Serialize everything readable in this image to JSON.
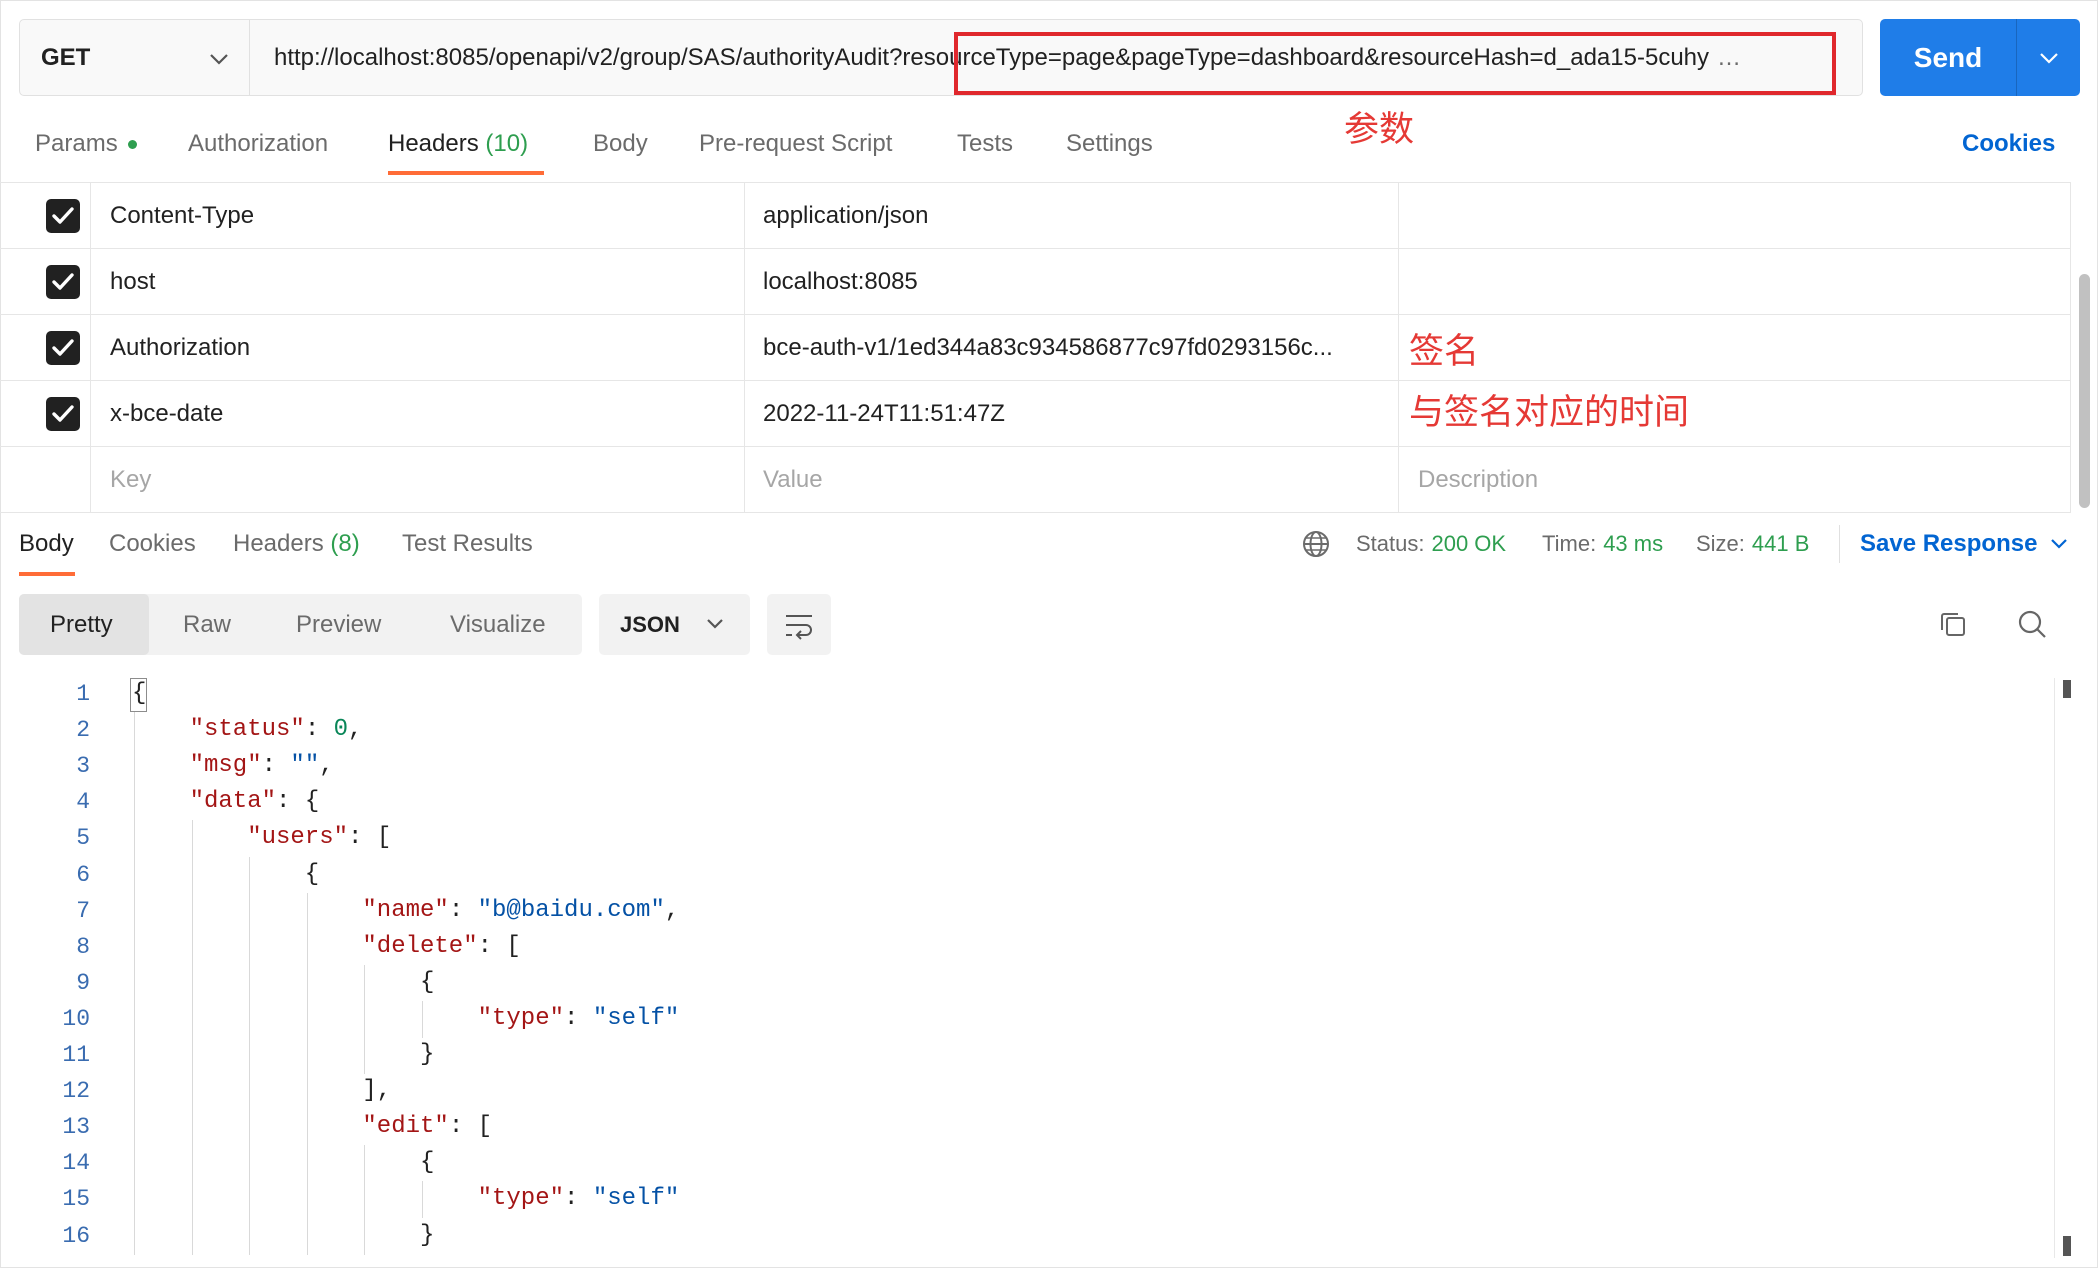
{
  "request": {
    "method": "GET",
    "url": "http://localhost:8085/openapi/v2/group/SAS/authorityAudit?resourceType=page&pageType=dashboard&resourceHash=d_ada15-5cuhy",
    "send_label": "Send"
  },
  "request_tabs": {
    "params": "Params",
    "params_has_values": true,
    "authorization": "Authorization",
    "headers": "Headers",
    "headers_count": "(10)",
    "body": "Body",
    "pre_request_script": "Pre-request Script",
    "tests": "Tests",
    "settings": "Settings",
    "active": "Headers",
    "cookies_link": "Cookies"
  },
  "annotations": {
    "params_note": "参数",
    "signature_note": "签名",
    "signature_time_note": "与签名对应的时间"
  },
  "headers_table": {
    "rows": [
      {
        "checked": true,
        "key": "Content-Type",
        "value": "application/json",
        "description": ""
      },
      {
        "checked": true,
        "key": "host",
        "value": "localhost:8085",
        "description": ""
      },
      {
        "checked": true,
        "key": "Authorization",
        "value": "bce-auth-v1/1ed344a83c934586877c97fd0293156c...",
        "description": ""
      },
      {
        "checked": true,
        "key": "x-bce-date",
        "value": "2022-11-24T11:51:47Z",
        "description": ""
      }
    ],
    "placeholder": {
      "key": "Key",
      "value": "Value",
      "description": "Description"
    }
  },
  "response_tabs": {
    "body": "Body",
    "cookies": "Cookies",
    "headers": "Headers",
    "headers_count": "(8)",
    "test_results": "Test Results",
    "active": "Body"
  },
  "response_status": {
    "status_label": "Status:",
    "status_value": "200 OK",
    "time_label": "Time:",
    "time_value": "43 ms",
    "size_label": "Size:",
    "size_value": "441 B",
    "save_response": "Save Response"
  },
  "response_toolbar": {
    "view_modes": [
      "Pretty",
      "Raw",
      "Preview",
      "Visualize"
    ],
    "selected_mode": "Pretty",
    "format": "JSON"
  },
  "response_body": {
    "lines": [
      {
        "n": "1",
        "indent": 0,
        "tokens": [
          {
            "type": "punct",
            "text": "{"
          }
        ]
      },
      {
        "n": "2",
        "indent": 1,
        "tokens": [
          {
            "type": "key",
            "text": "\"status\""
          },
          {
            "type": "punct",
            "text": ": "
          },
          {
            "type": "number",
            "text": "0"
          },
          {
            "type": "punct",
            "text": ","
          }
        ]
      },
      {
        "n": "3",
        "indent": 1,
        "tokens": [
          {
            "type": "key",
            "text": "\"msg\""
          },
          {
            "type": "punct",
            "text": ": "
          },
          {
            "type": "string",
            "text": "\"\""
          },
          {
            "type": "punct",
            "text": ","
          }
        ]
      },
      {
        "n": "4",
        "indent": 1,
        "tokens": [
          {
            "type": "key",
            "text": "\"data\""
          },
          {
            "type": "punct",
            "text": ": {"
          }
        ]
      },
      {
        "n": "5",
        "indent": 2,
        "tokens": [
          {
            "type": "key",
            "text": "\"users\""
          },
          {
            "type": "punct",
            "text": ": ["
          }
        ]
      },
      {
        "n": "6",
        "indent": 3,
        "tokens": [
          {
            "type": "punct",
            "text": "{"
          }
        ]
      },
      {
        "n": "7",
        "indent": 4,
        "tokens": [
          {
            "type": "key",
            "text": "\"name\""
          },
          {
            "type": "punct",
            "text": ": "
          },
          {
            "type": "string",
            "text": "\"b@baidu.com\""
          },
          {
            "type": "punct",
            "text": ","
          }
        ]
      },
      {
        "n": "8",
        "indent": 4,
        "tokens": [
          {
            "type": "key",
            "text": "\"delete\""
          },
          {
            "type": "punct",
            "text": ": ["
          }
        ]
      },
      {
        "n": "9",
        "indent": 5,
        "tokens": [
          {
            "type": "punct",
            "text": "{"
          }
        ]
      },
      {
        "n": "10",
        "indent": 6,
        "tokens": [
          {
            "type": "key",
            "text": "\"type\""
          },
          {
            "type": "punct",
            "text": ": "
          },
          {
            "type": "string",
            "text": "\"self\""
          }
        ]
      },
      {
        "n": "11",
        "indent": 5,
        "tokens": [
          {
            "type": "punct",
            "text": "}"
          }
        ]
      },
      {
        "n": "12",
        "indent": 4,
        "tokens": [
          {
            "type": "punct",
            "text": "],"
          }
        ]
      },
      {
        "n": "13",
        "indent": 4,
        "tokens": [
          {
            "type": "key",
            "text": "\"edit\""
          },
          {
            "type": "punct",
            "text": ": ["
          }
        ]
      },
      {
        "n": "14",
        "indent": 5,
        "tokens": [
          {
            "type": "punct",
            "text": "{"
          }
        ]
      },
      {
        "n": "15",
        "indent": 6,
        "tokens": [
          {
            "type": "key",
            "text": "\"type\""
          },
          {
            "type": "punct",
            "text": ": "
          },
          {
            "type": "string",
            "text": "\"self\""
          }
        ]
      },
      {
        "n": "16",
        "indent": 5,
        "tokens": [
          {
            "type": "punct",
            "text": "}"
          }
        ]
      }
    ]
  },
  "colors": {
    "accent_orange": "#ff6c37",
    "link_blue": "#0265d2",
    "send_blue": "#1f7de8",
    "success_green": "#2e9e4f",
    "annotation_red": "#e53935",
    "json_key": "#a31515",
    "json_string": "#0451a5",
    "json_number": "#098658",
    "json_punct": "#212121"
  },
  "icons": {
    "method_dropdown": "chevron-down-icon",
    "send_dropdown": "chevron-down-icon",
    "header_checkbox": "checkbox-checked-icon",
    "network": "globe-icon",
    "save_dropdown": "chevron-down-icon",
    "format_dropdown": "chevron-down-icon",
    "wrap": "wrap-lines-icon",
    "copy": "copy-icon",
    "search": "search-icon"
  }
}
